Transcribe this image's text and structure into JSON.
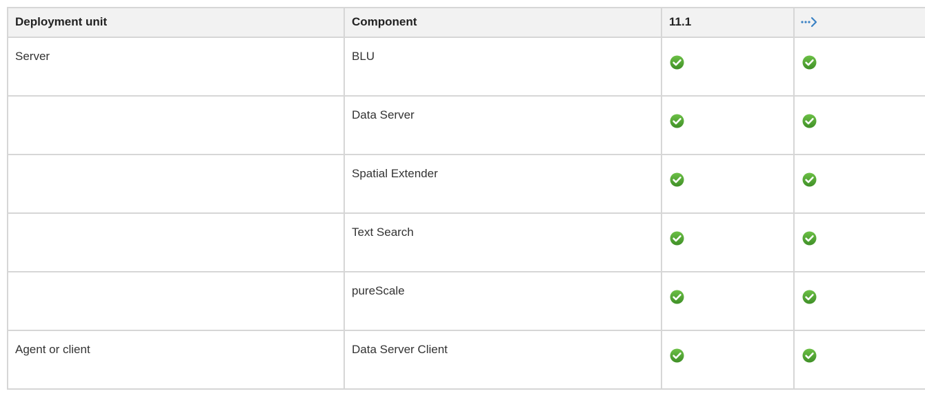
{
  "table": {
    "headers": {
      "deployment_unit": "Deployment unit",
      "component": "Component",
      "version": "11.1",
      "next_version_icon": "dotted-arrow-right-icon"
    },
    "rows": [
      {
        "deployment_unit": "Server",
        "component": "BLU",
        "supported_11_1": true,
        "supported_next": true
      },
      {
        "deployment_unit": "",
        "component": "Data Server",
        "supported_11_1": true,
        "supported_next": true
      },
      {
        "deployment_unit": "",
        "component": "Spatial Extender",
        "supported_11_1": true,
        "supported_next": true
      },
      {
        "deployment_unit": "",
        "component": "Text Search",
        "supported_11_1": true,
        "supported_next": true
      },
      {
        "deployment_unit": "",
        "component": "pureScale",
        "supported_11_1": true,
        "supported_next": true
      },
      {
        "deployment_unit": "Agent or client",
        "component": "Data Server Client",
        "supported_11_1": true,
        "supported_next": true
      }
    ]
  },
  "colors": {
    "header_bg": "#f2f2f2",
    "border": "#d6d6d6",
    "check_green": "#4a9a2e",
    "arrow_blue": "#3b82c4"
  }
}
